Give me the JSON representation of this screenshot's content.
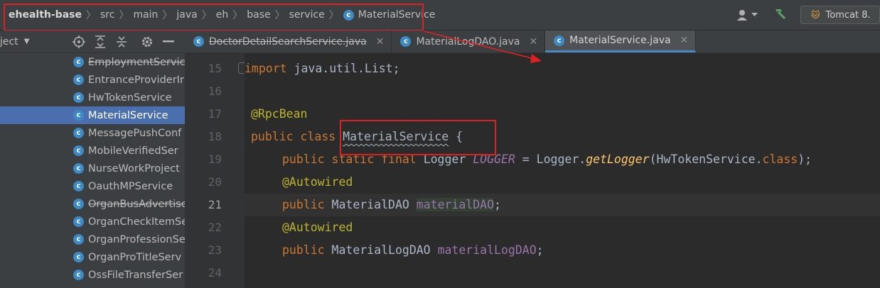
{
  "breadcrumb": {
    "items": [
      "ehealth-base",
      "src",
      "main",
      "java",
      "eh",
      "base",
      "service"
    ],
    "current_file": "MaterialService",
    "separator": "〉"
  },
  "toolbar_right": {
    "run_config_label": "Tomcat 8."
  },
  "project_panel": {
    "title": "ject",
    "dropdown_glyph": "▼"
  },
  "tabs": [
    {
      "label": "DoctorDetailSearchService.java",
      "active": false
    },
    {
      "label": "MaterialLogDAO.java",
      "active": false
    },
    {
      "label": "MaterialService.java",
      "active": true
    }
  ],
  "tree_items": [
    {
      "label": "EmploymentServic",
      "strike": true,
      "selected": false
    },
    {
      "label": "EntranceProviderIr",
      "strike": false,
      "selected": false
    },
    {
      "label": "HwTokenService",
      "strike": false,
      "selected": false
    },
    {
      "label": "MaterialService",
      "strike": false,
      "selected": true
    },
    {
      "label": "MessagePushConf",
      "strike": false,
      "selected": false
    },
    {
      "label": "MobileVerifiedSer",
      "strike": false,
      "selected": false
    },
    {
      "label": "NurseWorkProject",
      "strike": false,
      "selected": false
    },
    {
      "label": "OauthMPService",
      "strike": false,
      "selected": false
    },
    {
      "label": "OrganBusAdvertise",
      "strike": true,
      "selected": false
    },
    {
      "label": "OrganCheckItemSe",
      "strike": false,
      "selected": false
    },
    {
      "label": "OrganProfessionSe",
      "strike": false,
      "selected": false
    },
    {
      "label": "OrganProTitleServ",
      "strike": false,
      "selected": false
    },
    {
      "label": "OssFileTransferSer",
      "strike": false,
      "selected": false
    }
  ],
  "code": {
    "line_numbers": [
      "15",
      "16",
      "17",
      "18",
      "19",
      "20",
      "21",
      "22",
      "23",
      "24"
    ],
    "current_line": "21",
    "l15": {
      "kw": "import",
      "rest": " java.util.List;"
    },
    "l17": {
      "ann": "@RpcBean"
    },
    "l18": {
      "kw": "public class ",
      "name": "MaterialService",
      "rest": " {"
    },
    "l19": {
      "kw": "public static final ",
      "type": "Logger ",
      "field": "LOGGER",
      "eq": " = Logger.",
      "method": "getLogger",
      "args": "(HwTokenService.",
      "kw2": "class",
      "end": ");"
    },
    "l20": {
      "ann": "@Autowired"
    },
    "l21": {
      "kw": "public ",
      "type": "MaterialDAO ",
      "field": "materialDAO",
      "end": ";"
    },
    "l22": {
      "ann": "@Autowired"
    },
    "l23": {
      "kw": "public ",
      "type": "MaterialLogDAO ",
      "field": "materialLogDAO",
      "end": ";"
    }
  },
  "colors": {
    "keyword": "#cc7832",
    "annotation": "#bbb529",
    "field": "#9876aa",
    "method": "#ffc66d",
    "selection": "#4b6eaf",
    "highlight_box": "#e02020"
  }
}
